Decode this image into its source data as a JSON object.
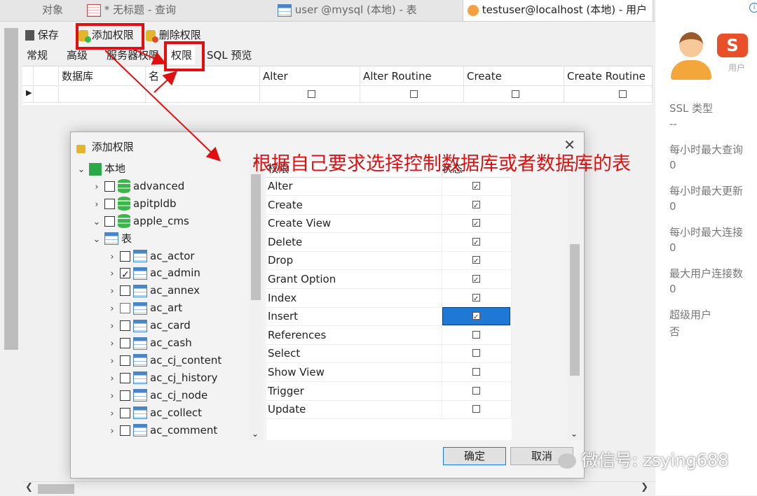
{
  "tabs": [
    {
      "label": "对象"
    },
    {
      "label": "* 无标题 - 查询"
    },
    {
      "label": "user @mysql (本地) - 表"
    },
    {
      "label": "testuser@localhost (本地) - 用户"
    }
  ],
  "toolbar": {
    "save": "保存",
    "add_priv": "添加权限",
    "del_priv": "删除权限"
  },
  "subtabs": [
    "常规",
    "高级",
    "服务器权限",
    "权限",
    "SQL 预览"
  ],
  "grid": {
    "headers": [
      "数据库",
      "名",
      "Alter",
      "Alter Routine",
      "Create",
      "Create Routine"
    ]
  },
  "right_panel": {
    "user_label": "用户",
    "ssl_label": "SSL 类型",
    "ssl_value": "--",
    "q1_label": "每小时最大查询",
    "q1_value": "0",
    "q2_label": "每小时最大更新",
    "q2_value": "0",
    "q3_label": "每小时最大连接",
    "q3_value": "0",
    "q4_label": "最大用户连接数",
    "q4_value": "0",
    "q5_label": "超级用户",
    "q5_value": "否"
  },
  "dialog": {
    "title": "添加权限",
    "tree": [
      {
        "label": "本地",
        "level": 0,
        "kind": "server"
      },
      {
        "label": "advanced",
        "level": 1,
        "kind": "db"
      },
      {
        "label": "apitpldb",
        "level": 1,
        "kind": "db"
      },
      {
        "label": "apple_cms",
        "level": 1,
        "kind": "db"
      },
      {
        "label": "表",
        "level": 2,
        "kind": "folder"
      },
      {
        "label": "ac_actor",
        "level": 3,
        "kind": "table",
        "state": "none"
      },
      {
        "label": "ac_admin",
        "level": 3,
        "kind": "table",
        "state": "checked"
      },
      {
        "label": "ac_annex",
        "level": 3,
        "kind": "table",
        "state": "none"
      },
      {
        "label": "ac_art",
        "level": 3,
        "kind": "table",
        "state": "partial"
      },
      {
        "label": "ac_card",
        "level": 3,
        "kind": "table",
        "state": "none"
      },
      {
        "label": "ac_cash",
        "level": 3,
        "kind": "table",
        "state": "none"
      },
      {
        "label": "ac_cj_content",
        "level": 3,
        "kind": "table",
        "state": "none"
      },
      {
        "label": "ac_cj_history",
        "level": 3,
        "kind": "table",
        "state": "none"
      },
      {
        "label": "ac_cj_node",
        "level": 3,
        "kind": "table",
        "state": "none"
      },
      {
        "label": "ac_collect",
        "level": 3,
        "kind": "table",
        "state": "none"
      },
      {
        "label": "ac_comment",
        "level": 3,
        "kind": "table",
        "state": "none"
      }
    ],
    "priv_header": {
      "name": "权限",
      "status": "状态"
    },
    "privileges": [
      {
        "name": "Alter",
        "checked": true
      },
      {
        "name": "Create",
        "checked": true
      },
      {
        "name": "Create View",
        "checked": true
      },
      {
        "name": "Delete",
        "checked": true
      },
      {
        "name": "Drop",
        "checked": true
      },
      {
        "name": "Grant Option",
        "checked": true
      },
      {
        "name": "Index",
        "checked": true
      },
      {
        "name": "Insert",
        "checked": true,
        "selected": true
      },
      {
        "name": "References",
        "checked": false
      },
      {
        "name": "Select",
        "checked": false
      },
      {
        "name": "Show View",
        "checked": false
      },
      {
        "name": "Trigger",
        "checked": false
      },
      {
        "name": "Update",
        "checked": false
      }
    ],
    "ok": "确定",
    "cancel": "取消"
  },
  "annotation": "根据自己要求选择控制数据库或者数据库的表",
  "watermark": "微信号: zsying688",
  "colors": {
    "red": "#e01010",
    "accent": "#1e78d6"
  }
}
